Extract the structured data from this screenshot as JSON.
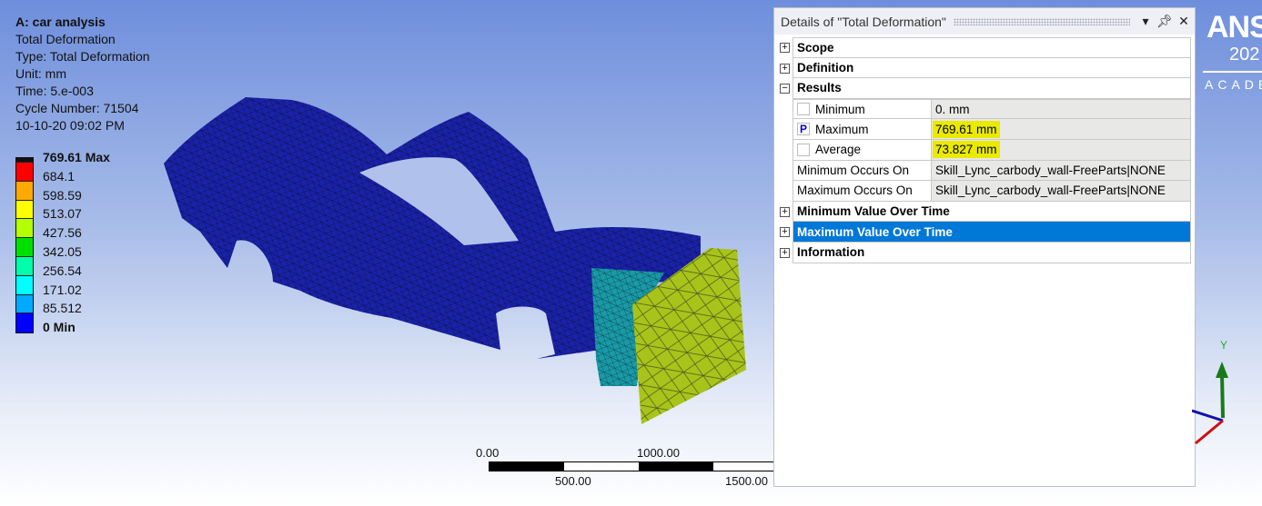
{
  "info": {
    "title": "A: car analysis",
    "result": "Total Deformation",
    "type": "Type: Total Deformation",
    "unit": "Unit: mm",
    "time": "Time: 5.e-003",
    "cycle": "Cycle Number: 71504",
    "date": "10-10-20 09:02 PM"
  },
  "legend": {
    "labels": [
      "769.61 Max",
      "684.1",
      "598.59",
      "513.07",
      "427.56",
      "342.05",
      "256.54",
      "171.02",
      "85.512",
      "0 Min"
    ],
    "colors": [
      "#ff0000",
      "#ffaa00",
      "#ffff00",
      "#b4ff00",
      "#00e000",
      "#00ffaa",
      "#00ffff",
      "#00aaff",
      "#0000ff"
    ]
  },
  "scale": {
    "labels": [
      "0.00",
      "1000.00",
      "500.00",
      "1500.00"
    ]
  },
  "panel": {
    "title": "Details of \"Total Deformation\"",
    "sections": {
      "scope": "Scope",
      "definition": "Definition",
      "results": "Results",
      "min_over_time": "Minimum Value Over Time",
      "max_over_time": "Maximum Value Over Time",
      "information": "Information"
    },
    "results": [
      {
        "label": "Minimum",
        "value": "0. mm",
        "check": ""
      },
      {
        "label": "Maximum",
        "value": "769.61 mm",
        "check": "P"
      },
      {
        "label": "Average",
        "value": "73.827 mm",
        "check": ""
      },
      {
        "label": "Minimum Occurs On",
        "value": "Skill_Lync_carbody_wall-FreeParts|NONE"
      },
      {
        "label": "Maximum Occurs On",
        "value": "Skill_Lync_carbody_wall-FreeParts|NONE"
      }
    ],
    "highlight_color": "#eaea00",
    "selected_color": "#0078d7"
  },
  "logo": {
    "brand": "ANS",
    "year": "202",
    "sub": "ACADE"
  },
  "axes": {
    "y": "Y"
  }
}
